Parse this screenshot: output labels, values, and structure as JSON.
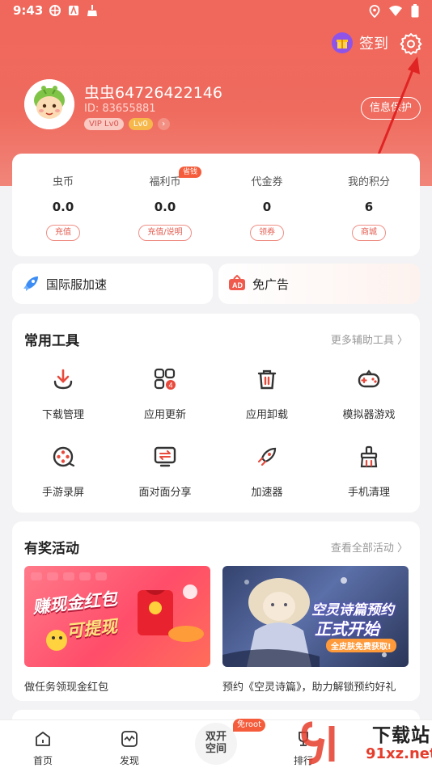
{
  "status_bar": {
    "time": "9:43"
  },
  "header": {
    "sign_label": "签到",
    "protect_label": "信息保护"
  },
  "user": {
    "name": "虫虫64726422146",
    "id": "ID: 83655881",
    "vip": "VIP",
    "vip_level": "Lv0",
    "level": "Lv0"
  },
  "stats": [
    {
      "label": "虫币",
      "value": "0.0",
      "action": "充值"
    },
    {
      "label": "福利币",
      "value": "0.0",
      "action": "充值/说明",
      "tag": "省钱"
    },
    {
      "label": "代金券",
      "value": "0",
      "action": "领券"
    },
    {
      "label": "我的积分",
      "value": "6",
      "action": "商城"
    }
  ],
  "quick": {
    "left": "国际服加速",
    "right": "免广告"
  },
  "tools": {
    "title": "常用工具",
    "more": "更多辅助工具 〉",
    "items": [
      {
        "label": "下载管理",
        "icon": "download-icon"
      },
      {
        "label": "应用更新",
        "icon": "app-update-icon"
      },
      {
        "label": "应用卸载",
        "icon": "trash-icon"
      },
      {
        "label": "模拟器游戏",
        "icon": "gamepad-icon"
      },
      {
        "label": "手游录屏",
        "icon": "film-reel-icon"
      },
      {
        "label": "面对面分享",
        "icon": "share-icon"
      },
      {
        "label": "加速器",
        "icon": "rocket-icon"
      },
      {
        "label": "手机清理",
        "icon": "broom-icon"
      }
    ]
  },
  "events": {
    "title": "有奖活动",
    "more": "查看全部活动 〉",
    "banner1": {
      "line1": "赚现金红包",
      "line2": "可提现",
      "caption": "做任务领现金红包"
    },
    "banner2": {
      "line1": "空灵诗篇预约",
      "line2": "正式开始",
      "line3": "全皮肤免费获取!",
      "caption": "预约《空灵诗篇》，助力解锁预约好礼"
    }
  },
  "tabbar": {
    "home": "首页",
    "discover": "发现",
    "center_line1": "双开",
    "center_line2": "空间",
    "center_tag": "免root",
    "rank": "排行"
  },
  "watermark": {
    "big": "下载站",
    "small": "91xz.net"
  },
  "colors": {
    "accent": "#ef6b5e",
    "annotation_arrow": "#e02424"
  }
}
